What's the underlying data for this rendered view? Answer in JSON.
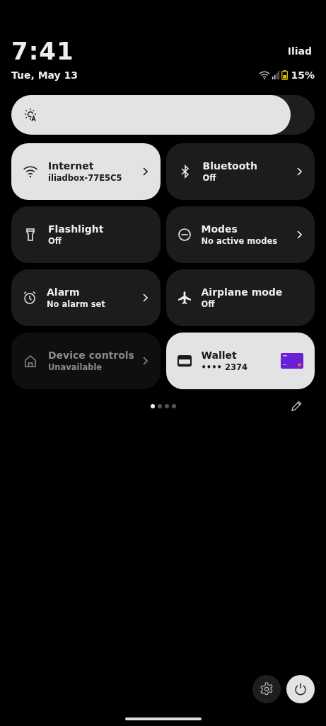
{
  "status": {
    "time": "7:41",
    "date": "Tue, May 13",
    "carrier": "Iliad",
    "battery": "15%"
  },
  "brightness": {
    "level": 0.92
  },
  "tiles": [
    {
      "kind": "toggle",
      "title": "Internet",
      "subtitle": "iliadbox-77E5C5",
      "on": true,
      "disabled": false,
      "expandable": true
    },
    {
      "kind": "toggle",
      "title": "Bluetooth",
      "subtitle": "Off",
      "on": false,
      "disabled": false,
      "expandable": true
    },
    {
      "kind": "toggle",
      "title": "Flashlight",
      "subtitle": "Off",
      "on": false,
      "disabled": false,
      "expandable": false
    },
    {
      "kind": "toggle",
      "title": "Modes",
      "subtitle": "No active modes",
      "on": false,
      "disabled": false,
      "expandable": true
    },
    {
      "kind": "toggle",
      "title": "Alarm",
      "subtitle": "No alarm set",
      "on": false,
      "disabled": false,
      "expandable": true
    },
    {
      "kind": "toggle",
      "title": "Airplane mode",
      "subtitle": "Off",
      "on": false,
      "disabled": false,
      "expandable": false
    },
    {
      "kind": "toggle",
      "title": "Device controls",
      "subtitle": "Unavailable",
      "on": false,
      "disabled": true,
      "expandable": true
    },
    {
      "kind": "wallet",
      "title": "Wallet",
      "subtitle": "•••• 2374",
      "on": true,
      "disabled": false,
      "expandable": false
    }
  ],
  "pages": [
    {
      "selected": true
    },
    {
      "selected": false
    },
    {
      "selected": false
    },
    {
      "selected": false
    }
  ]
}
